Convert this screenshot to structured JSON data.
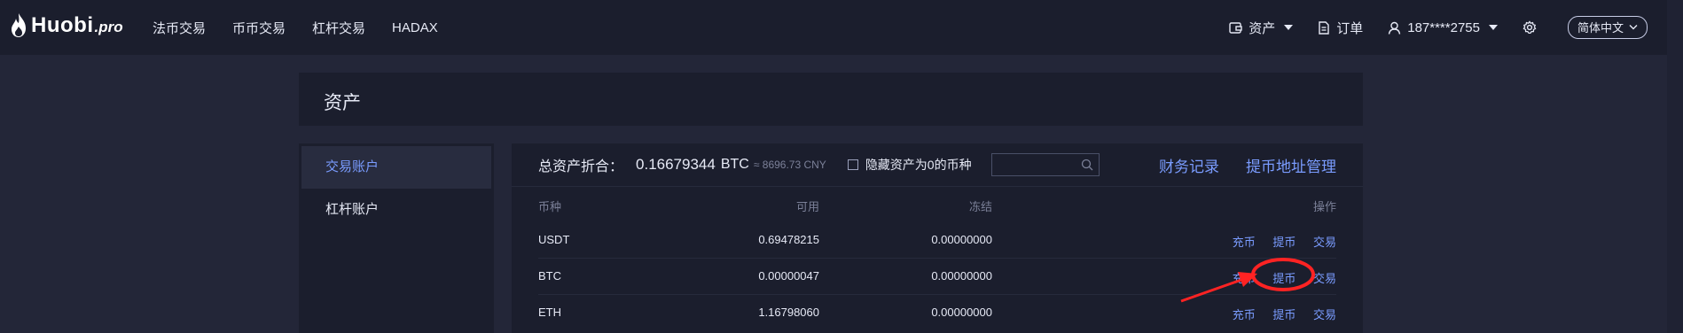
{
  "brand": {
    "name": "Huobi",
    "suffix": ".pro"
  },
  "nav": {
    "links": [
      "法币交易",
      "币币交易",
      "杠杆交易",
      "HADAX"
    ],
    "right": {
      "assets": "资产",
      "orders": "订单",
      "account": "187****2755",
      "language": "简体中文"
    }
  },
  "page": {
    "title": "资产"
  },
  "sidebar": {
    "items": [
      {
        "label": "交易账户",
        "active": true
      },
      {
        "label": "杠杆账户",
        "active": false
      }
    ]
  },
  "summary": {
    "label": "总资产折合：",
    "btc_value": "0.16679344",
    "btc_unit": "BTC",
    "cny": "≈ 8696.73 CNY",
    "hide_zero_label": "隐藏资产为0的币种",
    "search_value": ""
  },
  "links": {
    "finance_records": "财务记录",
    "withdraw_address": "提币地址管理"
  },
  "table": {
    "headers": {
      "coin": "币种",
      "available": "可用",
      "frozen": "冻结",
      "ops": "操作"
    },
    "ops_labels": {
      "deposit": "充币",
      "withdraw": "提币",
      "trade": "交易"
    },
    "rows": [
      {
        "coin": "USDT",
        "available": "0.69478215",
        "frozen": "0.00000000"
      },
      {
        "coin": "BTC",
        "available": "0.00000047",
        "frozen": "0.00000000"
      },
      {
        "coin": "ETH",
        "available": "1.16798060",
        "frozen": "0.00000000"
      }
    ]
  },
  "colors": {
    "background": "#232638",
    "panel": "#1b1e2d",
    "accent": "#7a9cff",
    "annotation": "#ff2323"
  }
}
